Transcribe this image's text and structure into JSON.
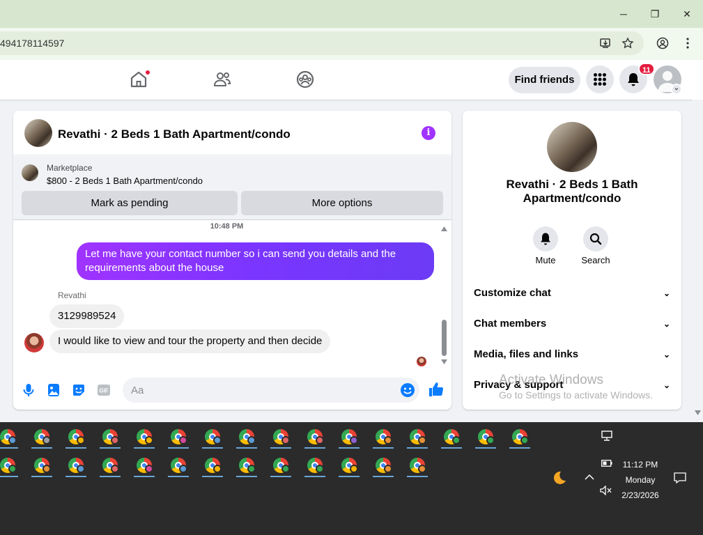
{
  "browser": {
    "url": "494178114597",
    "window_controls": {
      "minimize": "─",
      "maximize": "❐",
      "close": "✕"
    }
  },
  "nav": {
    "home_icon": "home-icon",
    "notification_dot_color": "#e41e3f",
    "find_friends_label": "Find friends",
    "notifications_count": "11"
  },
  "chat": {
    "title": "Revathi · 2 Beds 1 Bath Apartment/condo",
    "info_glyph": "i",
    "marketplace_label": "Marketplace",
    "listing": "$800 - 2 Beds 1 Bath Apartment/condo",
    "mark_pending_label": "Mark as pending",
    "more_options_label": "More options",
    "timestamp": "10:48 PM",
    "outgoing_message": "Let me have your contact number so i can send you details and the requirements about the house",
    "sender_name": "Revathi",
    "incoming_messages": [
      "3129989524",
      "I would like to view and tour the property and then decide"
    ],
    "composer_placeholder": "Aa",
    "accent_color": "#0a7cff",
    "bubble_gradient": "#a033ff"
  },
  "panel": {
    "name": "Revathi · 2 Beds 1 Bath Apartment/condo",
    "mute_label": "Mute",
    "search_label": "Search",
    "sections": [
      "Customize chat",
      "Chat members",
      "Media, files and links",
      "Privacy & support"
    ],
    "chevron": "⌄"
  },
  "watermark": {
    "line1": "Activate Windows",
    "line2": "Go to Settings to activate Windows."
  },
  "taskbar": {
    "time": "11:12 PM",
    "day": "Monday",
    "date": "2/23/2026",
    "profile_colors_row1": [
      "#5b9bd5",
      "#9aa0a6",
      "#f4b400",
      "#e06666",
      "#f4b400",
      "#d64a9a",
      "#5b9bd5",
      "#5b9bd5",
      "#e06666",
      "#e06666",
      "#8e63ce",
      "#e69138",
      "#e69138",
      "#34a853",
      "#34a853",
      "#34a853"
    ],
    "profile_colors_row2": [
      "#34a853",
      "#e69138",
      "#5b9bd5",
      "#e06666",
      "#d64a9a",
      "#5b9bd5",
      "#f4b400",
      "#34a853",
      "#34a853",
      "#34a853",
      "#f4b400",
      "#e69138",
      "#e69138"
    ]
  }
}
